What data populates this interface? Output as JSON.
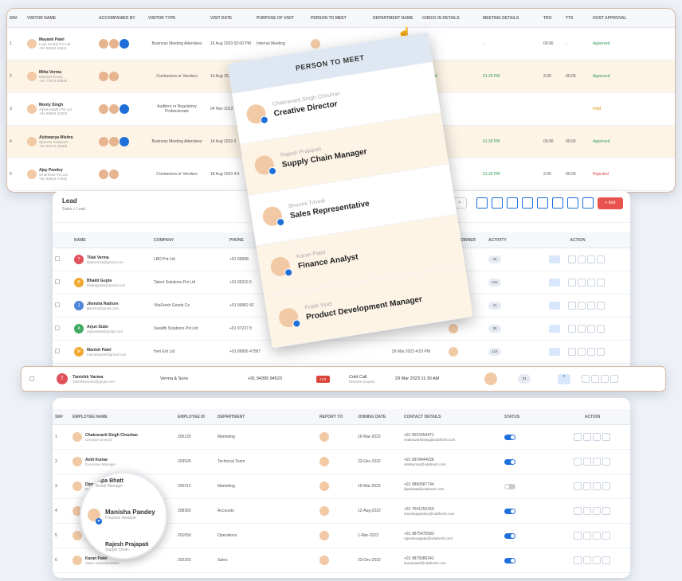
{
  "visitors": {
    "columns": [
      "SR#",
      "VISITOR NAME",
      "ACCOMPANIED BY",
      "VISITOR TYPE",
      "VISIT DATE",
      "PURPOSE OF VISIT",
      "PERSON TO MEET",
      "DEPARTMENT NAME",
      "CHECK IN DETAILS",
      "MEETING DETAILS",
      "TRO",
      "TTS",
      "HOST APPROVAL"
    ],
    "rows": [
      {
        "sr": "1",
        "name": "Mayank Patel",
        "company": "Luxe Dental Pvt Ltd",
        "phone": "+91 93234 54611",
        "type": "Business Meeting Attendees",
        "date": "16 Aug 2023 02:00 PM",
        "purpose": "Internal Meeting",
        "dept": "Marketing",
        "checkin": "-",
        "meeting": "-",
        "tro": "00:00",
        "tts": "-",
        "approval": "Approved",
        "status": "ok"
      },
      {
        "sr": "2",
        "name": "Mitta Verma",
        "company": "Mindset Group",
        "phone": "+91 77874 55932",
        "type": "Contractors or Vendors",
        "date": "14 Aug 2023",
        "purpose": "",
        "dept": "Operations",
        "checkin": "1:00 PM",
        "meeting": "01:30 PM",
        "tro": "2:00",
        "tts": "00:00",
        "approval": "Approved",
        "status": "ok"
      },
      {
        "sr": "3",
        "name": "Monty Singh",
        "company": "Alpha Health Pvt Ltd",
        "phone": "+91 88063 34322",
        "type": "Auditors or Regulatory Professionals",
        "date": "04 Nov 2023",
        "purpose": "",
        "dept": "Sales",
        "checkin": "01:00 PM",
        "meeting": "",
        "tro": "",
        "tts": "",
        "approval": "Hold",
        "status": "warn"
      },
      {
        "sr": "4",
        "name": "Aishwarya Mishra",
        "company": "Spencer Solutions",
        "phone": "+91 88171 45466",
        "type": "Business Meeting Attendees",
        "date": "14 Aug 2023 0",
        "purpose": "",
        "dept": "Accounts",
        "checkin": "01:00 PM",
        "meeting": "01:30 PM",
        "tro": "00:00",
        "tts": "00:00",
        "approval": "Approved",
        "status": "ok"
      },
      {
        "sr": "5",
        "name": "Ajay Pandey",
        "company": "Smarthost Pvt Ltd",
        "phone": "+91 94515 47542",
        "type": "Contractors or Vendors",
        "date": "18 Aug 2023 4:3",
        "purpose": "",
        "dept": "Admin",
        "checkin": "01:00 PM",
        "meeting": "01:30 PM",
        "tro": "2:00",
        "tts": "00:00",
        "approval": "Rejected",
        "status": "bad"
      }
    ]
  },
  "dropdown": {
    "title": "PERSON TO MEET",
    "people": [
      {
        "name": "Chakravarti Singh Chouhan",
        "role": "Creative Director"
      },
      {
        "name": "Rajesh Prajapati",
        "role": "Supply Chain Manager"
      },
      {
        "name": "Bhoomi Trivedi",
        "role": "Sales Representative"
      },
      {
        "name": "Karan Patel",
        "role": "Finance Analyst"
      },
      {
        "name": "Pratik Vyas",
        "role": "Product Development Manager"
      }
    ]
  },
  "leads": {
    "title": "Lead",
    "breadcrumb_1": "Sales",
    "breadcrumb_2": "Lead",
    "add_label": "+ Add",
    "columns": [
      "",
      "NAME",
      "COMPANY",
      "PHONE",
      "",
      "",
      "",
      "LEAD OWNER",
      "ACTIVITY",
      "ACTION"
    ],
    "rows": [
      {
        "initial": "T",
        "color": "#e0525b",
        "name": "Tilak Verma",
        "email": "tilakverma@gmail.com",
        "company": "LBD Pvt Ltd",
        "phone": "+91 99898",
        "activity": "36"
      },
      {
        "initial": "B",
        "color": "#f1a830",
        "name": "Bhakti Gupta",
        "email": "bhaktigupta@gmail.com",
        "company": "Talent Solutions Pvt Ltd",
        "phone": "+91 93316 5",
        "activity": "102"
      },
      {
        "initial": "J",
        "color": "#4e86d9",
        "name": "Jitendra Rathore",
        "email": "jitendra@gmail.com",
        "company": "VitaFresh Goods Co",
        "phone": "+91 99982 42",
        "activity": "41"
      },
      {
        "initial": "A",
        "color": "#3fa960",
        "name": "Arjun Dube",
        "email": "arjundube@gmail.com",
        "company": "Swadhi Solutions Pvt Ltd",
        "phone": "+91 97227 8",
        "activity": "38"
      },
      {
        "initial": "M",
        "color": "#f1a830",
        "name": "Manish Patel",
        "email": "manishpatel@gmail.com",
        "company": "Heri Ent Ltd",
        "phone": "+91 99806 47587",
        "date": "29 Mar 2023 4:03 PM",
        "activity": "116"
      }
    ]
  },
  "highlight_row": {
    "initial": "T",
    "name": "Tanishk Varma",
    "email": "Tanishkvarma@gmail.com",
    "company": "Verma & Sons",
    "phone": "+91 94395 94523",
    "badge": "Hot",
    "source": "Cold Call",
    "source_sub": "Website Enquiry",
    "date": "29 Mar 2023 11:30 AM",
    "activity": "31"
  },
  "employees": {
    "columns": [
      "SR#",
      "EMPLOYEE NAME",
      "EMPLOYEE ID",
      "DEPARTMENT",
      "REPORT TO",
      "JOINING DATE",
      "CONTACT DETAILS",
      "STATUS",
      "ACTION"
    ],
    "rows": [
      {
        "sr": "1",
        "name": "Chakravarti Singh Chouhan",
        "role": "Creative Director",
        "id": "205120",
        "dept": "Marketing",
        "date": "16-Mar-2023",
        "phone": "+91 9023454471",
        "email": "chakravarthising@vdafresh.com",
        "active": true
      },
      {
        "sr": "2",
        "name": "Amit Kumar",
        "role": "Executive Manager",
        "id": "203526",
        "dept": "Technical Team",
        "date": "23-Dec-2022",
        "phone": "+91 9978444028",
        "email": "amitkumar@vdafresh.com",
        "active": true
      },
      {
        "sr": "3",
        "name": "Dipa Bhatt",
        "role": "Brand Manager",
        "id": "205212",
        "dept": "Marketing",
        "date": "16-Mar-2023",
        "phone": "+91 9890587744",
        "email": "dipabhatt@vdafresh.com",
        "active": false
      },
      {
        "sr": "4",
        "name": "Manisha Pandey",
        "role": "Finance Analyst",
        "id": "208360",
        "dept": "Accounts",
        "date": "12-Aug-2022",
        "phone": "+91 7541252269",
        "email": "manishapandey@vdafresh.com",
        "active": true
      },
      {
        "sr": "5",
        "name": "Rajesh Prajapati",
        "role": "Supply Chain",
        "id": "201059",
        "dept": "Operations",
        "date": "1-Mar-2023",
        "phone": "+91 9875470583",
        "email": "rajeshprajapati@vdafresh.com",
        "active": true
      },
      {
        "sr": "6",
        "name": "Karan Patel",
        "role": "Sales Representative",
        "id": "202203",
        "dept": "Sales",
        "date": "23-Dec-2022",
        "phone": "+91 9875586342",
        "email": "karanpatel@vdafresh.com",
        "active": true
      }
    ]
  },
  "magnifier": {
    "name": "Manisha Pandey",
    "role": "Finance Analyst",
    "above_name": "Dipa Bhatt",
    "above_role": "Brand Manager",
    "below_name": "Rajesh Prajapati",
    "below_role": "Supply Chain"
  },
  "colors": {
    "accent": "#1e6fd9",
    "hot": "#d9443b",
    "highlight": "#fdf4e6"
  }
}
